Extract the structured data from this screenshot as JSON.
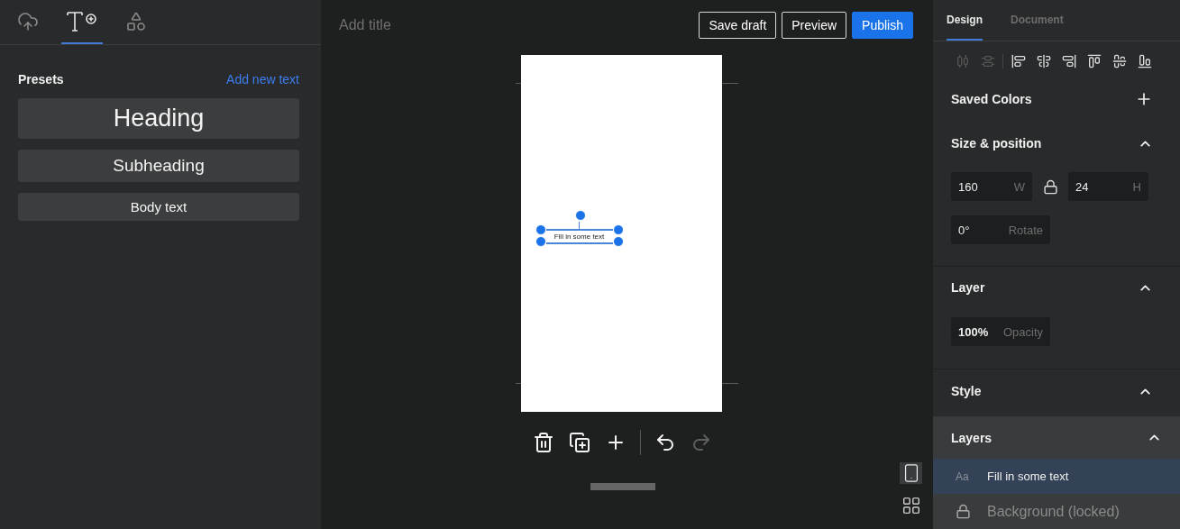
{
  "left_tabs": [
    {
      "kind": "upload",
      "selected": false
    },
    {
      "kind": "text",
      "selected": true
    },
    {
      "kind": "shapes",
      "selected": false
    }
  ],
  "presets": {
    "title": "Presets",
    "link": "Add new text",
    "items": [
      {
        "label": "Heading",
        "kind": "heading"
      },
      {
        "label": "Subheading",
        "kind": "subheading"
      },
      {
        "label": "Body text",
        "kind": "body"
      }
    ]
  },
  "header": {
    "title_placeholder": "Add title",
    "buttons": [
      {
        "label": "Save draft",
        "kind": "outline"
      },
      {
        "label": "Preview",
        "kind": "outline"
      },
      {
        "label": "Publish",
        "kind": "primary"
      }
    ]
  },
  "canvas": {
    "selected_text": "Fill in some text"
  },
  "toolbar": [
    {
      "kind": "delete",
      "disabled": false
    },
    {
      "kind": "duplicate",
      "disabled": false
    },
    {
      "kind": "add",
      "disabled": false
    },
    {
      "kind": "undo",
      "disabled": false
    },
    {
      "kind": "redo",
      "disabled": true
    }
  ],
  "view_toggles": [
    {
      "kind": "page",
      "selected": true
    },
    {
      "kind": "grid",
      "selected": false
    }
  ],
  "right_tabs": [
    {
      "label": "Design",
      "selected": true
    },
    {
      "label": "Document",
      "selected": false
    }
  ],
  "align_buttons": [
    {
      "kind": "distribute-h",
      "disabled": true
    },
    {
      "kind": "distribute-v",
      "disabled": true
    },
    {
      "kind": "left",
      "disabled": false
    },
    {
      "kind": "center-h",
      "disabled": false
    },
    {
      "kind": "right",
      "disabled": false
    },
    {
      "kind": "top",
      "disabled": false
    },
    {
      "kind": "center-v",
      "disabled": false
    },
    {
      "kind": "bottom",
      "disabled": false
    }
  ],
  "saved_colors": {
    "title": "Saved Colors"
  },
  "size_position": {
    "title": "Size & position",
    "expanded": true,
    "width": {
      "value": "160",
      "label": "W"
    },
    "height": {
      "value": "24",
      "label": "H"
    },
    "rotate": {
      "value": "0°",
      "label": "Rotate"
    }
  },
  "layer": {
    "title": "Layer",
    "expanded": true,
    "opacity": {
      "value": "100%",
      "label": "Opacity"
    }
  },
  "style": {
    "title": "Style",
    "expanded": true
  },
  "layers": {
    "title": "Layers",
    "expanded": true,
    "items": [
      {
        "label": "Fill in some text",
        "kind": "text",
        "badge": "Aa",
        "selected": true
      },
      {
        "label": "Background (locked)",
        "kind": "locked",
        "selected": false
      }
    ]
  }
}
